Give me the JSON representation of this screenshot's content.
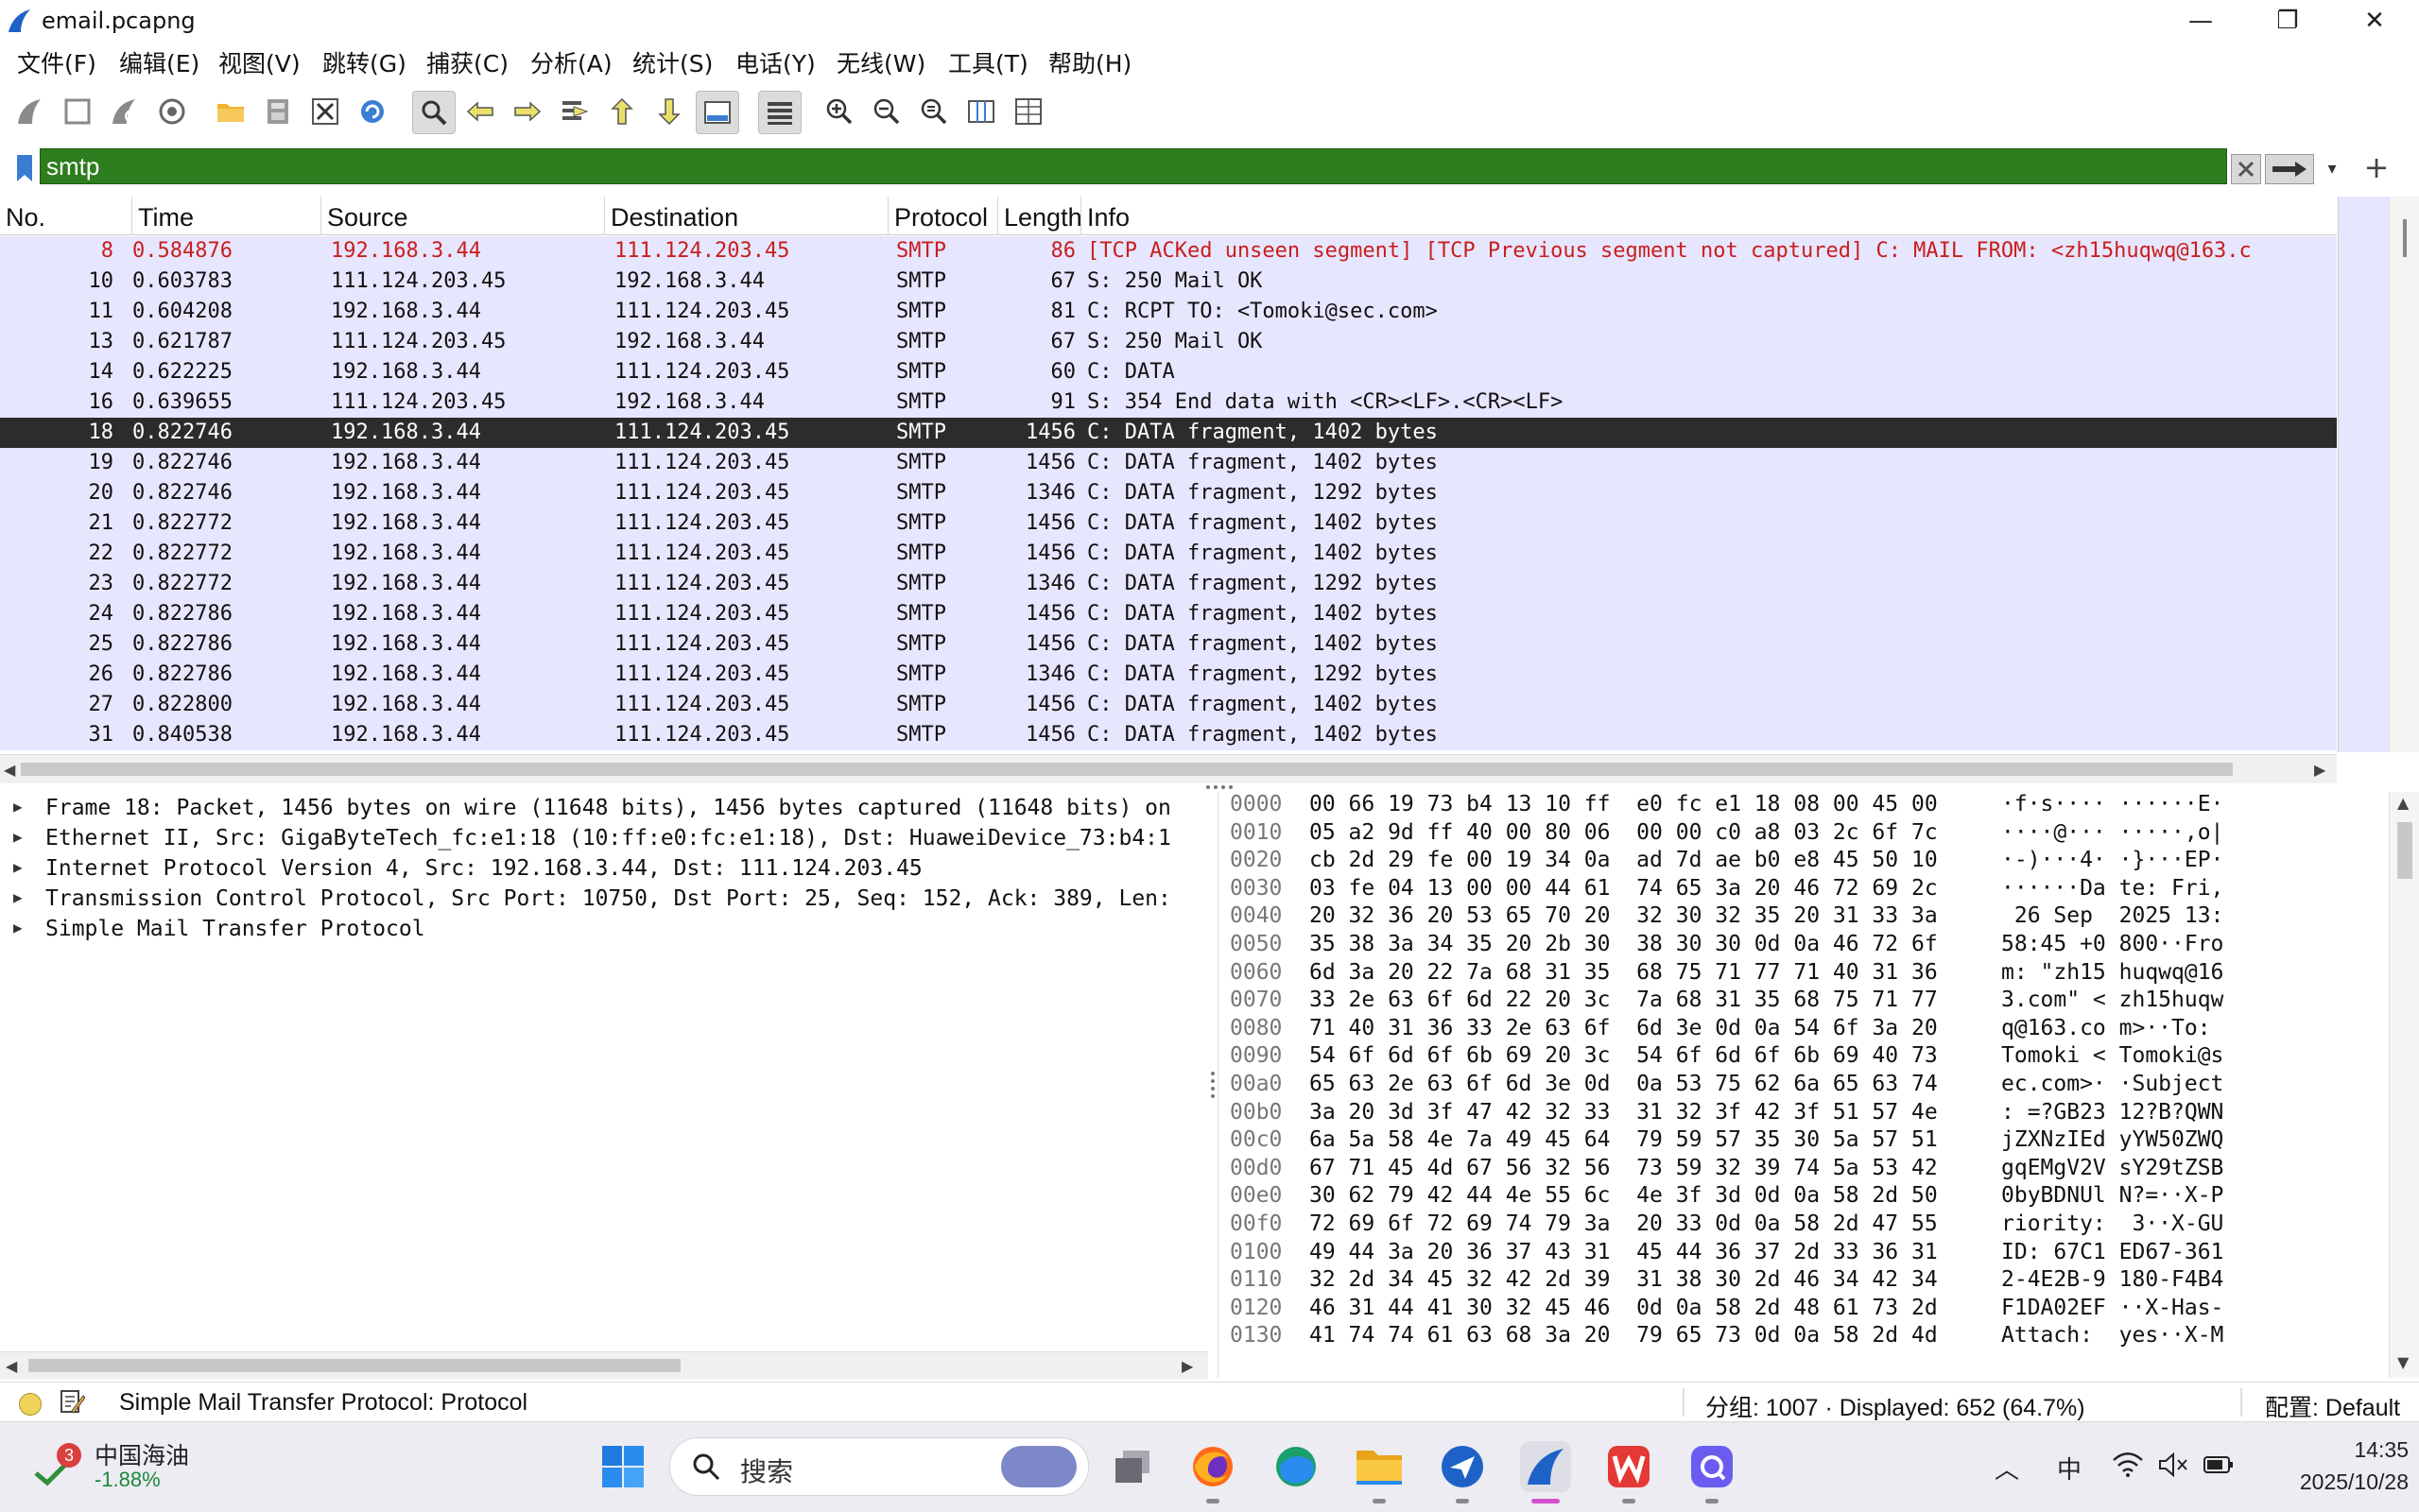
{
  "window": {
    "title": "email.pcapng",
    "minimize": "—",
    "maximize": "❐",
    "close": "✕"
  },
  "menu": [
    {
      "label": "文件(F)"
    },
    {
      "label": "编辑(E)"
    },
    {
      "label": "视图(V)"
    },
    {
      "label": "跳转(G)"
    },
    {
      "label": "捕获(C)"
    },
    {
      "label": "分析(A)"
    },
    {
      "label": "统计(S)"
    },
    {
      "label": "电话(Y)"
    },
    {
      "label": "无线(W)"
    },
    {
      "label": "工具(T)"
    },
    {
      "label": "帮助(H)"
    }
  ],
  "toolbar": {
    "icons": [
      "start-capture-icon",
      "stop-capture-icon",
      "restart-capture-icon",
      "capture-options-icon",
      "open-file-icon",
      "save-file-icon",
      "close-file-icon",
      "reload-file-icon",
      "find-packet-icon",
      "go-back-icon",
      "go-forward-icon",
      "go-to-packet-icon",
      "first-packet-icon",
      "last-packet-icon",
      "auto-scroll-icon",
      "colorize-icon",
      "zoom-in-icon",
      "zoom-out-icon",
      "normal-size-icon",
      "resize-columns-icon",
      "packet-bytes-icon"
    ]
  },
  "filter": {
    "value": "smtp",
    "color": "#2e7d1e"
  },
  "packet_list": {
    "columns": [
      "No.",
      "Time",
      "Source",
      "Destination",
      "Protocol",
      "Length",
      "Info"
    ],
    "rows": [
      {
        "no": "8",
        "time": "0.584876",
        "src": "192.168.3.44",
        "dst": "111.124.203.45",
        "proto": "SMTP",
        "len": "86",
        "info": "[TCP ACKed unseen segment] [TCP Previous segment not captured] C: MAIL FROM: <zh15huqwq@163.c",
        "style": "warn"
      },
      {
        "no": "10",
        "time": "0.603783",
        "src": "111.124.203.45",
        "dst": "192.168.3.44",
        "proto": "SMTP",
        "len": "67",
        "info": "S: 250 Mail OK",
        "style": ""
      },
      {
        "no": "11",
        "time": "0.604208",
        "src": "192.168.3.44",
        "dst": "111.124.203.45",
        "proto": "SMTP",
        "len": "81",
        "info": "C: RCPT TO: <Tomoki@sec.com>",
        "style": ""
      },
      {
        "no": "13",
        "time": "0.621787",
        "src": "111.124.203.45",
        "dst": "192.168.3.44",
        "proto": "SMTP",
        "len": "67",
        "info": "S: 250 Mail OK",
        "style": ""
      },
      {
        "no": "14",
        "time": "0.622225",
        "src": "192.168.3.44",
        "dst": "111.124.203.45",
        "proto": "SMTP",
        "len": "60",
        "info": "C: DATA",
        "style": ""
      },
      {
        "no": "16",
        "time": "0.639655",
        "src": "111.124.203.45",
        "dst": "192.168.3.44",
        "proto": "SMTP",
        "len": "91",
        "info": "S: 354 End data with <CR><LF>.<CR><LF>",
        "style": ""
      },
      {
        "no": "18",
        "time": "0.822746",
        "src": "192.168.3.44",
        "dst": "111.124.203.45",
        "proto": "SMTP",
        "len": "1456",
        "info": "C: DATA fragment, 1402 bytes",
        "style": "selected"
      },
      {
        "no": "19",
        "time": "0.822746",
        "src": "192.168.3.44",
        "dst": "111.124.203.45",
        "proto": "SMTP",
        "len": "1456",
        "info": "C: DATA fragment, 1402 bytes",
        "style": ""
      },
      {
        "no": "20",
        "time": "0.822746",
        "src": "192.168.3.44",
        "dst": "111.124.203.45",
        "proto": "SMTP",
        "len": "1346",
        "info": "C: DATA fragment, 1292 bytes",
        "style": ""
      },
      {
        "no": "21",
        "time": "0.822772",
        "src": "192.168.3.44",
        "dst": "111.124.203.45",
        "proto": "SMTP",
        "len": "1456",
        "info": "C: DATA fragment, 1402 bytes",
        "style": ""
      },
      {
        "no": "22",
        "time": "0.822772",
        "src": "192.168.3.44",
        "dst": "111.124.203.45",
        "proto": "SMTP",
        "len": "1456",
        "info": "C: DATA fragment, 1402 bytes",
        "style": ""
      },
      {
        "no": "23",
        "time": "0.822772",
        "src": "192.168.3.44",
        "dst": "111.124.203.45",
        "proto": "SMTP",
        "len": "1346",
        "info": "C: DATA fragment, 1292 bytes",
        "style": ""
      },
      {
        "no": "24",
        "time": "0.822786",
        "src": "192.168.3.44",
        "dst": "111.124.203.45",
        "proto": "SMTP",
        "len": "1456",
        "info": "C: DATA fragment, 1402 bytes",
        "style": ""
      },
      {
        "no": "25",
        "time": "0.822786",
        "src": "192.168.3.44",
        "dst": "111.124.203.45",
        "proto": "SMTP",
        "len": "1456",
        "info": "C: DATA fragment, 1402 bytes",
        "style": ""
      },
      {
        "no": "26",
        "time": "0.822786",
        "src": "192.168.3.44",
        "dst": "111.124.203.45",
        "proto": "SMTP",
        "len": "1346",
        "info": "C: DATA fragment, 1292 bytes",
        "style": ""
      },
      {
        "no": "27",
        "time": "0.822800",
        "src": "192.168.3.44",
        "dst": "111.124.203.45",
        "proto": "SMTP",
        "len": "1456",
        "info": "C: DATA fragment, 1402 bytes",
        "style": ""
      },
      {
        "no": "31",
        "time": "0.840538",
        "src": "192.168.3.44",
        "dst": "111.124.203.45",
        "proto": "SMTP",
        "len": "1456",
        "info": "C: DATA fragment, 1402 bytes",
        "style": ""
      }
    ]
  },
  "details": [
    "Frame 18: Packet, 1456 bytes on wire (11648 bits), 1456 bytes captured (11648 bits) on",
    "Ethernet II, Src: GigaByteTech_fc:e1:18 (10:ff:e0:fc:e1:18), Dst: HuaweiDevice_73:b4:1",
    "Internet Protocol Version 4, Src: 192.168.3.44, Dst: 111.124.203.45",
    "Transmission Control Protocol, Src Port: 10750, Dst Port: 25, Seq: 152, Ack: 389, Len:",
    "Simple Mail Transfer Protocol"
  ],
  "bytes": [
    {
      "off": "0000",
      "hex": "00 66 19 73 b4 13 10 ff  e0 fc e1 18 08 00 45 00",
      "asc": "·f·s···· ······E·"
    },
    {
      "off": "0010",
      "hex": "05 a2 9d ff 40 00 80 06  00 00 c0 a8 03 2c 6f 7c",
      "asc": "····@··· ·····,o|"
    },
    {
      "off": "0020",
      "hex": "cb 2d 29 fe 00 19 34 0a  ad 7d ae b0 e8 45 50 10",
      "asc": "·-)···4· ·}···EP·"
    },
    {
      "off": "0030",
      "hex": "03 fe 04 13 00 00 44 61  74 65 3a 20 46 72 69 2c",
      "asc": "······Da te: Fri,"
    },
    {
      "off": "0040",
      "hex": "20 32 36 20 53 65 70 20  32 30 32 35 20 31 33 3a",
      "asc": " 26 Sep  2025 13:"
    },
    {
      "off": "0050",
      "hex": "35 38 3a 34 35 20 2b 30  38 30 30 0d 0a 46 72 6f",
      "asc": "58:45 +0 800··Fro"
    },
    {
      "off": "0060",
      "hex": "6d 3a 20 22 7a 68 31 35  68 75 71 77 71 40 31 36",
      "asc": "m: \"zh15 huqwq@16"
    },
    {
      "off": "0070",
      "hex": "33 2e 63 6f 6d 22 20 3c  7a 68 31 35 68 75 71 77",
      "asc": "3.com\" < zh15huqw"
    },
    {
      "off": "0080",
      "hex": "71 40 31 36 33 2e 63 6f  6d 3e 0d 0a 54 6f 3a 20",
      "asc": "q@163.co m>··To: "
    },
    {
      "off": "0090",
      "hex": "54 6f 6d 6f 6b 69 20 3c  54 6f 6d 6f 6b 69 40 73",
      "asc": "Tomoki < Tomoki@s"
    },
    {
      "off": "00a0",
      "hex": "65 63 2e 63 6f 6d 3e 0d  0a 53 75 62 6a 65 63 74",
      "asc": "ec.com>· ·Subject"
    },
    {
      "off": "00b0",
      "hex": "3a 20 3d 3f 47 42 32 33  31 32 3f 42 3f 51 57 4e",
      "asc": ": =?GB23 12?B?QWN"
    },
    {
      "off": "00c0",
      "hex": "6a 5a 58 4e 7a 49 45 64  79 59 57 35 30 5a 57 51",
      "asc": "jZXNzIEd yYW50ZWQ"
    },
    {
      "off": "00d0",
      "hex": "67 71 45 4d 67 56 32 56  73 59 32 39 74 5a 53 42",
      "asc": "gqEMgV2V sY29tZSB"
    },
    {
      "off": "00e0",
      "hex": "30 62 79 42 44 4e 55 6c  4e 3f 3d 0d 0a 58 2d 50",
      "asc": "0byBDNUl N?=··X-P"
    },
    {
      "off": "00f0",
      "hex": "72 69 6f 72 69 74 79 3a  20 33 0d 0a 58 2d 47 55",
      "asc": "riority:  3··X-GU"
    },
    {
      "off": "0100",
      "hex": "49 44 3a 20 36 37 43 31  45 44 36 37 2d 33 36 31",
      "asc": "ID: 67C1 ED67-361"
    },
    {
      "off": "0110",
      "hex": "32 2d 34 45 32 42 2d 39  31 38 30 2d 46 34 42 34",
      "asc": "2-4E2B-9 180-F4B4"
    },
    {
      "off": "0120",
      "hex": "46 31 44 41 30 32 45 46  0d 0a 58 2d 48 61 73 2d",
      "asc": "F1DA02EF ··X-Has-"
    },
    {
      "off": "0130",
      "hex": "41 74 74 61 63 68 3a 20  79 65 73 0d 0a 58 2d 4d",
      "asc": "Attach:  yes··X-M"
    }
  ],
  "status": {
    "text": "Simple Mail Transfer Protocol: Protocol",
    "packets": "分组: 1007 · Displayed: 652 (64.7%)",
    "profile": "配置: Default"
  },
  "taskbar": {
    "stock_name": "中国海油",
    "stock_change": "-1.88%",
    "stock_badge": "3",
    "search_label": "搜索",
    "ime": "中",
    "time": "14:35",
    "date": "2025/10/28"
  }
}
